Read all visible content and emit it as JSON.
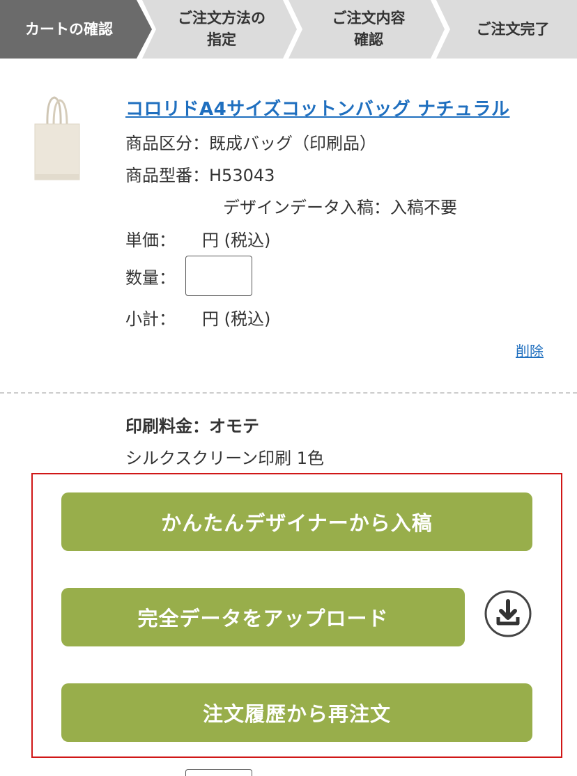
{
  "steps": [
    {
      "label": "カートの確認",
      "active": true
    },
    {
      "label": "ご注文方法の\n指定",
      "active": false
    },
    {
      "label": "ご注文内容\n確認",
      "active": false
    },
    {
      "label": "ご注文完了",
      "active": false
    }
  ],
  "product": {
    "name": "コロリドA4サイズコットンバッグ ナチュラル",
    "category": "商品区分：既成バッグ（印刷品）",
    "model": "商品型番：H53043",
    "design_data": "デザインデータ入稿：入稿不要",
    "unit_price_label": "単価：",
    "unit_price_suffix": "円 (税込)",
    "quantity_label": "数量：",
    "quantity_value": "",
    "subtotal_label": "小計：",
    "subtotal_suffix": "円 (税込)",
    "delete_label": "削除"
  },
  "print": {
    "title": "印刷料金：オモテ",
    "method": "シルクスクリーン印刷 1色"
  },
  "actions": {
    "designer_label": "かんたんデザイナーから入稿",
    "upload_label": "完全データをアップロード",
    "reorder_label": "注文履歴から再注文"
  },
  "colors": {
    "active_step": "#6b6b6b",
    "inactive_step": "#dcdcdc",
    "button": "#98ae4b",
    "link": "#1f6fbf",
    "highlight": "#d01717"
  }
}
